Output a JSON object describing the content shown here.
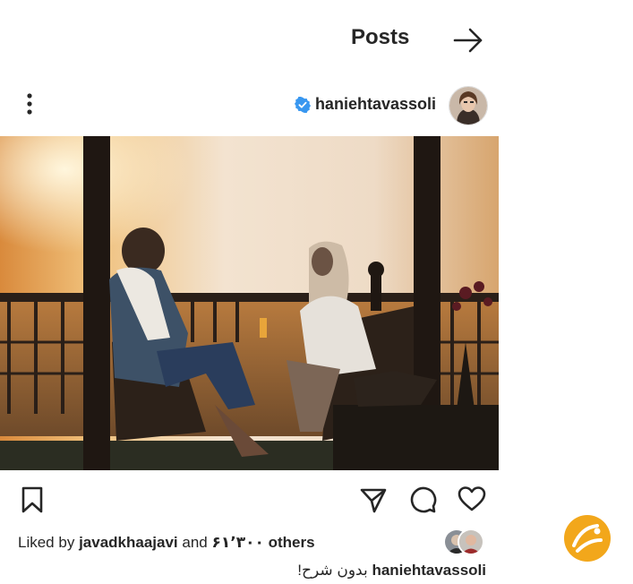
{
  "header": {
    "title": "Posts",
    "forward_icon": "arrow-right-icon"
  },
  "post": {
    "username": "haniehtavassoli",
    "verified": true,
    "more_icon": "more-vertical-icon",
    "photo_alt": "Sunset terrace scene",
    "actions": {
      "save_icon": "bookmark-icon",
      "share_icon": "share-icon",
      "comment_icon": "comment-icon",
      "like_icon": "heart-icon"
    },
    "likes": {
      "prefix": "Liked by",
      "first_liker": "javadkhaajavi",
      "connector": "and",
      "others_count": "۶۱٬۳۰۰",
      "others_label": "others"
    },
    "caption": {
      "username": "haniehtavassoli",
      "text": "بدون شرح!"
    }
  },
  "colors": {
    "text": "#262626",
    "verified": "#3897f0",
    "watermark": "#f2a71b"
  }
}
